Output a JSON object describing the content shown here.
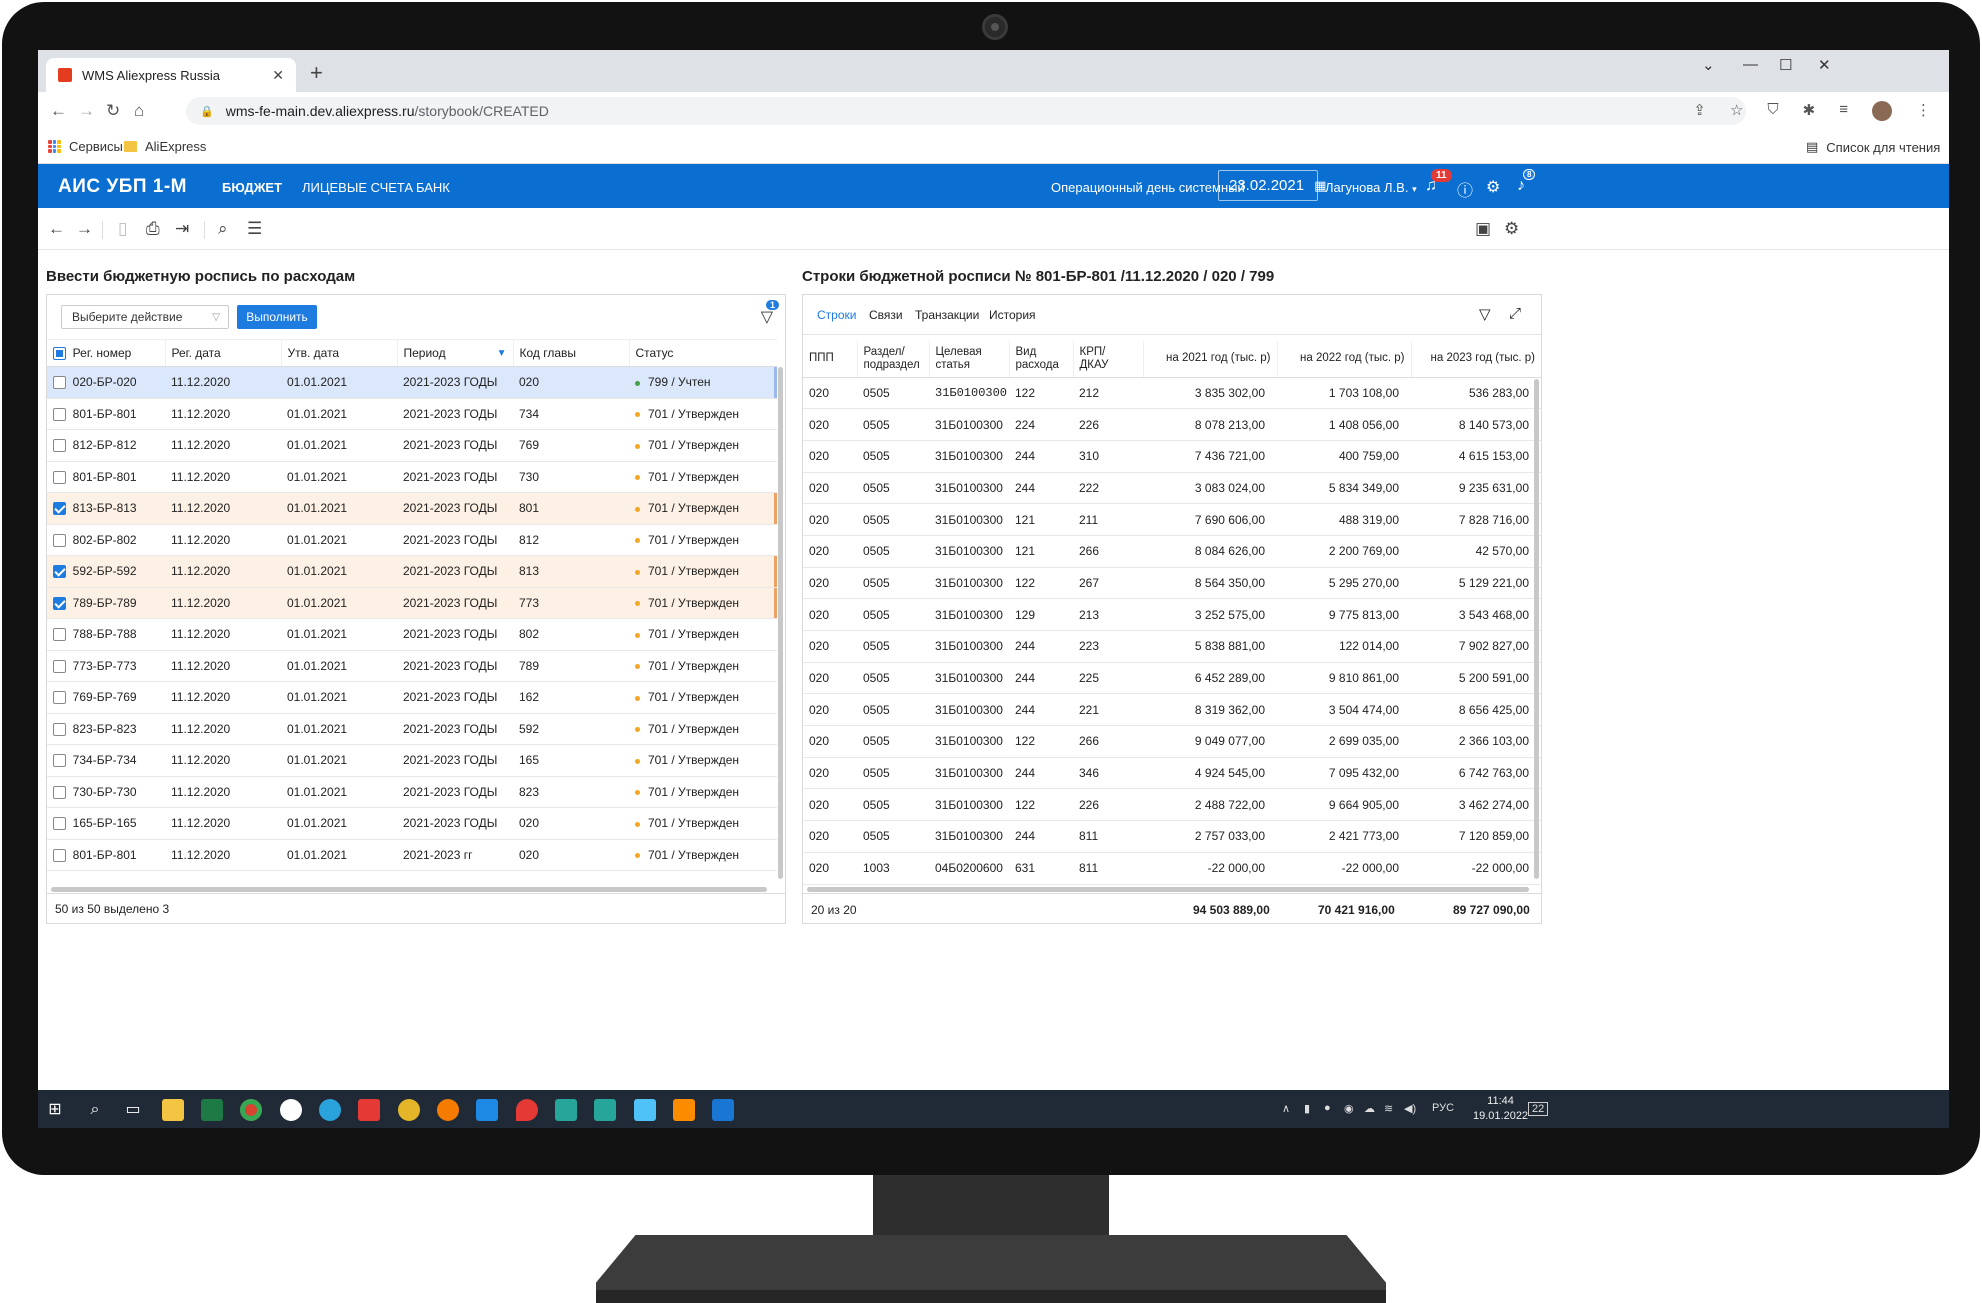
{
  "browser": {
    "tab_title": "WMS Aliexpress Russia",
    "url_host": "wms-fe-main.dev.aliexpress.ru",
    "url_path": "/storybook/CREATED",
    "bookmarks": [
      "Сервисы",
      "AliExpress"
    ],
    "reading_list": "Список для чтения"
  },
  "app": {
    "title": "АИС УБП 1-М",
    "nav": [
      "БЮДЖЕТ",
      "ЛИЦЕВЫЕ СЧЕТА",
      "БАНК"
    ],
    "op_day_label": "Операционный день системный",
    "op_date": "23.02.2021",
    "user": "Лагунова Л.В.",
    "notif_badge": "11",
    "bell_badge": "8",
    "accent": "#0b6fd1"
  },
  "left": {
    "title": "Ввести бюджетную роспись по расходам",
    "action_placeholder": "Выберите действие",
    "run_label": "Выполнить",
    "filter_badge": "1",
    "columns": [
      "Рег. номер",
      "Рег. дата",
      "Утв. дата",
      "Период",
      "Код главы",
      "Статус"
    ],
    "rows": [
      [
        "020-БР-020",
        "11.12.2020",
        "01.01.2021",
        "2021-2023 ГОДЫ",
        "020",
        "799 / Учтен"
      ],
      [
        "801-БР-801",
        "11.12.2020",
        "01.01.2021",
        "2021-2023 ГОДЫ",
        "734",
        "701 / Утвержден"
      ],
      [
        "812-БР-812",
        "11.12.2020",
        "01.01.2021",
        "2021-2023 ГОДЫ",
        "769",
        "701 / Утвержден"
      ],
      [
        "801-БР-801",
        "11.12.2020",
        "01.01.2021",
        "2021-2023 ГОДЫ",
        "730",
        "701 / Утвержден"
      ],
      [
        "813-БР-813",
        "11.12.2020",
        "01.01.2021",
        "2021-2023 ГОДЫ",
        "801",
        "701 / Утвержден"
      ],
      [
        "802-БР-802",
        "11.12.2020",
        "01.01.2021",
        "2021-2023 ГОДЫ",
        "812",
        "701 / Утвержден"
      ],
      [
        "592-БР-592",
        "11.12.2020",
        "01.01.2021",
        "2021-2023 ГОДЫ",
        "813",
        "701 / Утвержден"
      ],
      [
        "789-БР-789",
        "11.12.2020",
        "01.01.2021",
        "2021-2023 ГОДЫ",
        "773",
        "701 / Утвержден"
      ],
      [
        "788-БР-788",
        "11.12.2020",
        "01.01.2021",
        "2021-2023 ГОДЫ",
        "802",
        "701 / Утвержден"
      ],
      [
        "773-БР-773",
        "11.12.2020",
        "01.01.2021",
        "2021-2023 ГОДЫ",
        "789",
        "701 / Утвержден"
      ],
      [
        "769-БР-769",
        "11.12.2020",
        "01.01.2021",
        "2021-2023 ГОДЫ",
        "162",
        "701 / Утвержден"
      ],
      [
        "823-БР-823",
        "11.12.2020",
        "01.01.2021",
        "2021-2023 ГОДЫ",
        "592",
        "701 / Утвержден"
      ],
      [
        "734-БР-734",
        "11.12.2020",
        "01.01.2021",
        "2021-2023 ГОДЫ",
        "165",
        "701 / Утвержден"
      ],
      [
        "730-БР-730",
        "11.12.2020",
        "01.01.2021",
        "2021-2023 ГОДЫ",
        "823",
        "701 / Утвержден"
      ],
      [
        "165-БР-165",
        "11.12.2020",
        "01.01.2021",
        "2021-2023 ГОДЫ",
        "020",
        "701 / Утвержден"
      ],
      [
        "801-БР-801",
        "11.12.2020",
        "01.01.2021",
        "2021-2023 гг",
        "020",
        "701 / Утвержден"
      ]
    ],
    "row_state": [
      "active",
      "",
      "",
      "",
      "checked",
      "",
      "checked",
      "checked",
      "",
      "",
      "",
      "",
      "",
      "",
      "",
      ""
    ],
    "footer": "50 из 50 выделено 3"
  },
  "right": {
    "title": "Строки бюджетной росписи № 801-БР-801 /11.12.2020 / 020 / 799",
    "tabs": [
      "Строки",
      "Связи",
      "Транзакции",
      "История"
    ],
    "columns": [
      "ППП",
      "Раздел/ подраздел",
      "Целевая статья",
      "Вид расхода",
      "КРП/ ДКАУ",
      "на 2021 год (тыс. р)",
      "на 2022 год (тыс. р)",
      "на 2023 год (тыс. р)"
    ],
    "rows": [
      [
        "020",
        "0505",
        "31Б0100300",
        "122",
        "212",
        "3 835 302,00",
        "1 703 108,00",
        "536 283,00"
      ],
      [
        "020",
        "0505",
        "31Б0100300",
        "224",
        "226",
        "8 078 213,00",
        "1 408 056,00",
        "8 140 573,00"
      ],
      [
        "020",
        "0505",
        "31Б0100300",
        "244",
        "310",
        "7 436 721,00",
        "400 759,00",
        "4 615 153,00"
      ],
      [
        "020",
        "0505",
        "31Б0100300",
        "244",
        "222",
        "3 083 024,00",
        "5 834 349,00",
        "9 235 631,00"
      ],
      [
        "020",
        "0505",
        "31Б0100300",
        "121",
        "211",
        "7 690 606,00",
        "488 319,00",
        "7 828 716,00"
      ],
      [
        "020",
        "0505",
        "31Б0100300",
        "121",
        "266",
        "8 084 626,00",
        "2 200 769,00",
        "42 570,00"
      ],
      [
        "020",
        "0505",
        "31Б0100300",
        "122",
        "267",
        "8 564 350,00",
        "5 295 270,00",
        "5 129 221,00"
      ],
      [
        "020",
        "0505",
        "31Б0100300",
        "129",
        "213",
        "3 252 575,00",
        "9 775 813,00",
        "3 543 468,00"
      ],
      [
        "020",
        "0505",
        "31Б0100300",
        "244",
        "223",
        "5 838 881,00",
        "122 014,00",
        "7 902 827,00"
      ],
      [
        "020",
        "0505",
        "31Б0100300",
        "244",
        "225",
        "6 452 289,00",
        "9 810 861,00",
        "5 200 591,00"
      ],
      [
        "020",
        "0505",
        "31Б0100300",
        "244",
        "221",
        "8 319 362,00",
        "3 504 474,00",
        "8 656 425,00"
      ],
      [
        "020",
        "0505",
        "31Б0100300",
        "122",
        "266",
        "9 049 077,00",
        "2 699 035,00",
        "2 366 103,00"
      ],
      [
        "020",
        "0505",
        "31Б0100300",
        "244",
        "346",
        "4 924 545,00",
        "7 095 432,00",
        "6 742 763,00"
      ],
      [
        "020",
        "0505",
        "31Б0100300",
        "122",
        "226",
        "2 488 722,00",
        "9 664 905,00",
        "3 462 274,00"
      ],
      [
        "020",
        "0505",
        "31Б0100300",
        "244",
        "811",
        "2 757 033,00",
        "2 421 773,00",
        "7 120 859,00"
      ],
      [
        "020",
        "1003",
        "04Б0200600",
        "631",
        "811",
        "-22 000,00",
        "-22 000,00",
        "-22 000,00"
      ]
    ],
    "footer_count": "20 из 20",
    "total_2021": "94 503 889,00",
    "total_2022": "70 421 916,00",
    "total_2023": "89 727 090,00"
  },
  "taskbar": {
    "lang": "РУС",
    "time": "11:44",
    "date": "19.01.2022",
    "notif": "22"
  }
}
